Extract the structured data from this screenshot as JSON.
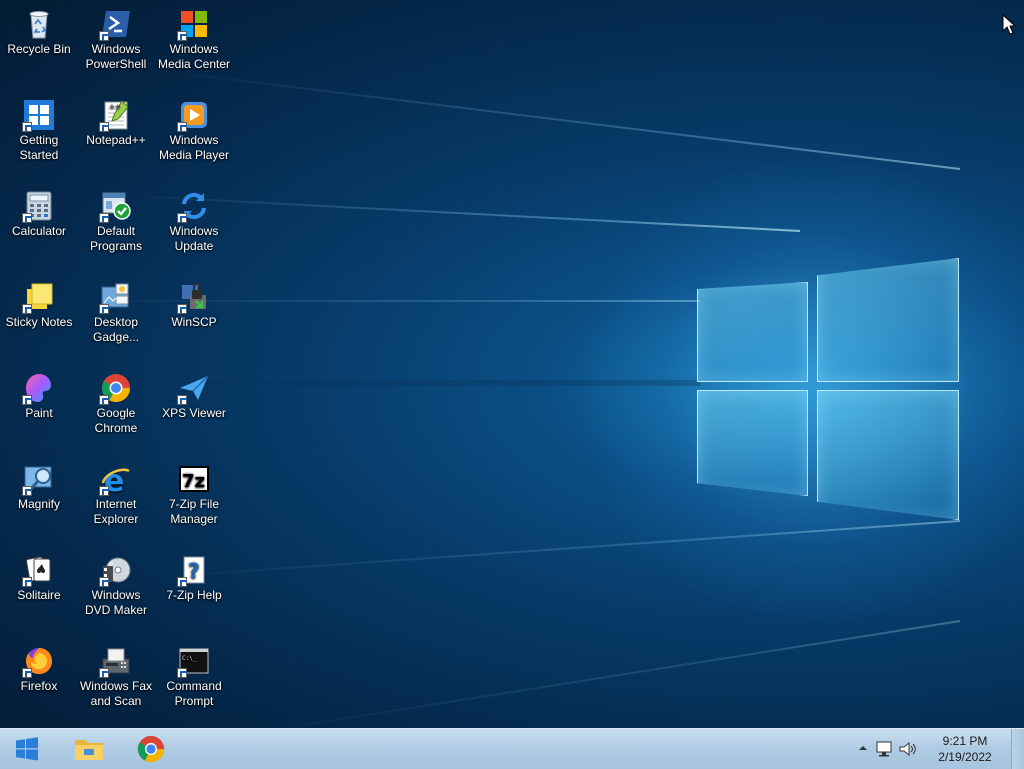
{
  "desktop": {
    "icons": [
      {
        "label": "Recycle Bin",
        "icon": "recycle-bin-icon"
      },
      {
        "label": "Windows PowerShell",
        "icon": "powershell-icon"
      },
      {
        "label": "Windows Media Center",
        "icon": "media-center-icon"
      },
      {
        "label": "Getting Started",
        "icon": "getting-started-icon"
      },
      {
        "label": "Notepad++",
        "icon": "notepadpp-icon"
      },
      {
        "label": "Windows Media Player",
        "icon": "media-player-icon"
      },
      {
        "label": "Calculator",
        "icon": "calculator-icon"
      },
      {
        "label": "Default Programs",
        "icon": "default-programs-icon"
      },
      {
        "label": "Windows Update",
        "icon": "windows-update-icon"
      },
      {
        "label": "Sticky Notes",
        "icon": "sticky-notes-icon"
      },
      {
        "label": "Desktop Gadge...",
        "icon": "desktop-gadgets-icon"
      },
      {
        "label": "WinSCP",
        "icon": "winscp-icon"
      },
      {
        "label": "Paint",
        "icon": "paint-icon"
      },
      {
        "label": "Google Chrome",
        "icon": "chrome-icon"
      },
      {
        "label": "XPS Viewer",
        "icon": "xps-viewer-icon"
      },
      {
        "label": "Magnify",
        "icon": "magnify-icon"
      },
      {
        "label": "Internet Explorer",
        "icon": "internet-explorer-icon"
      },
      {
        "label": "7-Zip File Manager",
        "icon": "7zip-icon"
      },
      {
        "label": "Solitaire",
        "icon": "solitaire-icon"
      },
      {
        "label": "Windows DVD Maker",
        "icon": "dvd-maker-icon"
      },
      {
        "label": "7-Zip Help",
        "icon": "help-icon"
      },
      {
        "label": "Firefox",
        "icon": "firefox-icon"
      },
      {
        "label": "Windows Fax and Scan",
        "icon": "fax-scan-icon"
      },
      {
        "label": "Command Prompt",
        "icon": "command-prompt-icon"
      }
    ]
  },
  "taskbar": {
    "start_icon": "windows-logo-icon",
    "pinned": [
      {
        "name": "File Explorer",
        "icon": "folder-icon"
      },
      {
        "name": "Google Chrome",
        "icon": "chrome-icon"
      }
    ],
    "tray": {
      "time": "9:21 PM",
      "date": "2/19/2022",
      "icons": [
        "chevron-up-icon",
        "network-icon",
        "volume-icon"
      ]
    }
  },
  "colors": {
    "taskbar": "#aecbe4",
    "wallpaper": "#073a68",
    "accent": "#1a7fb8"
  }
}
